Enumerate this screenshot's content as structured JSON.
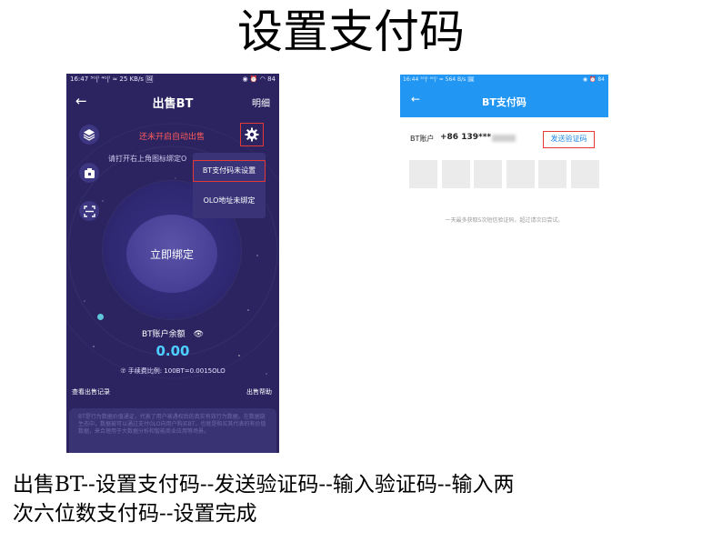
{
  "document": {
    "title": "设置支付码",
    "caption_line1": "出售BT--设置支付码--发送验证码--输入验证码--输入两",
    "caption_line2": "次六位数支付码--设置完成"
  },
  "left_screen": {
    "status_left": "16:47 ⁵ᴳ|ˡ ⁴ᴳ|ˡ ≈ 25 KB/s 🖼",
    "status_right": "◉ ⏰ ◠ 84",
    "title": "出售BT",
    "detail_label": "明细",
    "auto_sell_warning": "还未开启自动出售",
    "hint": "请打开右上角图标绑定O",
    "menu": {
      "pay_code_item": "BT支付码未设置",
      "olo_item": "OLO地址未绑定"
    },
    "bind_button": "立即绑定",
    "balance_label": "BT账户余额",
    "balance_value": "0.00",
    "fee_text": "⑦ 手续费比例: 100BT=0.0015OLO",
    "record_link": "查看出售记录",
    "help_link": "出售帮助",
    "info_text": "BT是行为数据价值通证，代表了用户被遇权后的真实有效行为数据。在数据链生态中，数据被可以通过支付OLO向用户购买BT，也就是购买其代表的有价值数据，来合理用于大数据分析和智能商业应用等场景。"
  },
  "right_screen": {
    "status_left": "16:44 ⁵ᴳ|ˡ ⁴ᴳ|ˡ ≈ 564 B/s 🖼",
    "status_right": "◉ ⏰ 84",
    "title": "BT支付码",
    "account_label": "BT账户",
    "account_number": "+86 139***",
    "send_code_button": "发送验证码",
    "code_box_count": 6,
    "note": "一天最多获取5次短信验证码，超过请次日尝试。"
  },
  "colors": {
    "left_bg": "#2b2461",
    "accent_blue": "#2196f3",
    "highlight_red": "#e53935",
    "balance_cyan": "#4dd0ff",
    "warning_red": "#ff5a5a"
  },
  "icons": [
    "back-arrow-icon",
    "layers-icon",
    "wallet-icon",
    "scan-icon",
    "gear-icon",
    "eye-icon"
  ]
}
